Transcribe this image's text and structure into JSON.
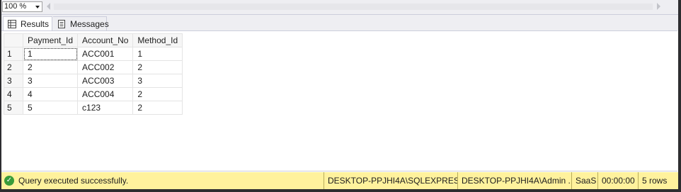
{
  "zoom": {
    "value": "100 %"
  },
  "tabs": [
    {
      "label": "Results",
      "icon": "grid-icon",
      "active": true
    },
    {
      "label": "Messages",
      "icon": "messages-icon",
      "active": false
    }
  ],
  "grid": {
    "columns": [
      "Payment_Id",
      "Account_No",
      "Method_Id"
    ],
    "rows": [
      {
        "num": "1",
        "cells": [
          "1",
          "ACC001",
          "1"
        ]
      },
      {
        "num": "2",
        "cells": [
          "2",
          "ACC002",
          "2"
        ]
      },
      {
        "num": "3",
        "cells": [
          "3",
          "ACC003",
          "3"
        ]
      },
      {
        "num": "4",
        "cells": [
          "4",
          "ACC004",
          "2"
        ]
      },
      {
        "num": "5",
        "cells": [
          "5",
          "c123",
          "2"
        ]
      }
    ]
  },
  "status": {
    "message": "Query executed successfully.",
    "server": "DESKTOP-PPJHI4A\\SQLEXPRESS ...",
    "user": "DESKTOP-PPJHI4A\\Admin ...",
    "database": "SaaS",
    "elapsed": "00:00:00",
    "rows": "5 rows",
    "color": "#fff29d"
  }
}
